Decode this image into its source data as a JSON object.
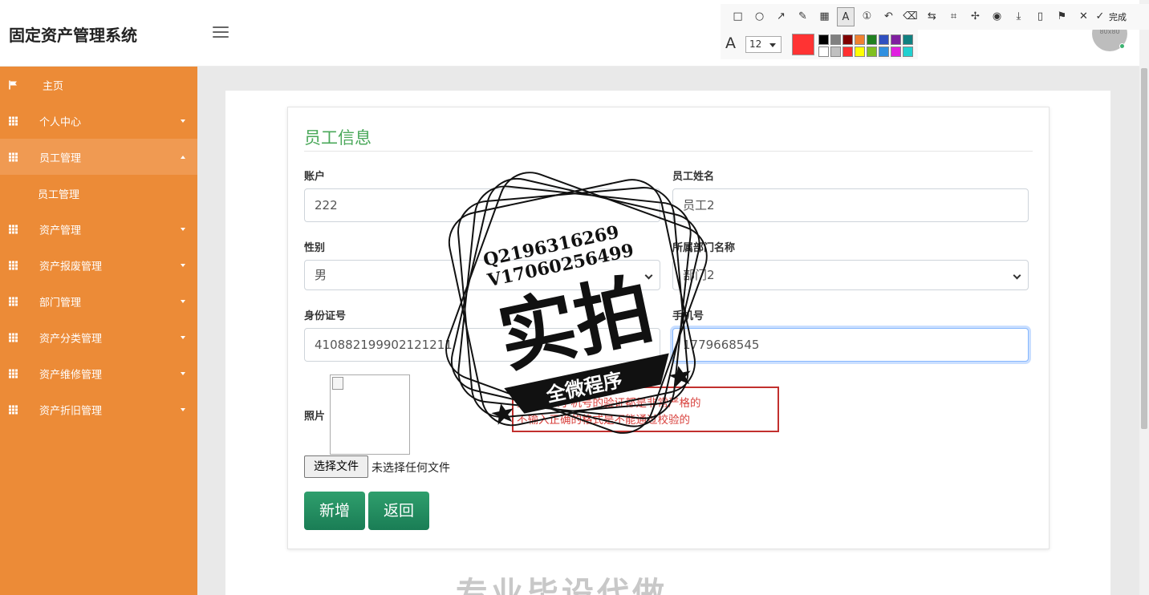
{
  "app": {
    "title": "固定资产管理系统"
  },
  "sidebar": {
    "items": [
      {
        "label": "主页",
        "icon": "flag-icon",
        "caret": "none"
      },
      {
        "label": "个人中心",
        "icon": "grid-icon",
        "caret": "down"
      },
      {
        "label": "员工管理",
        "icon": "grid-icon",
        "caret": "up",
        "active": true
      },
      {
        "label": "资产管理",
        "icon": "grid-icon",
        "caret": "down"
      },
      {
        "label": "资产报废管理",
        "icon": "grid-icon",
        "caret": "down"
      },
      {
        "label": "部门管理",
        "icon": "grid-icon",
        "caret": "down"
      },
      {
        "label": "资产分类管理",
        "icon": "grid-icon",
        "caret": "down"
      },
      {
        "label": "资产维修管理",
        "icon": "grid-icon",
        "caret": "down"
      },
      {
        "label": "资产折旧管理",
        "icon": "grid-icon",
        "caret": "down"
      }
    ],
    "sub_item": "员工管理"
  },
  "header": {
    "avatar_text": "80x80"
  },
  "form": {
    "title": "员工信息",
    "account": {
      "label": "账户",
      "value": "222"
    },
    "name": {
      "label": "员工姓名",
      "value": "员工2"
    },
    "gender": {
      "label": "性别",
      "value": "男"
    },
    "department": {
      "label": "所属部门名称",
      "value": "部门2"
    },
    "id_card": {
      "label": "身份证号",
      "value": "410882199902121211"
    },
    "phone": {
      "label": "手机号",
      "value": "1779668545"
    },
    "photo": {
      "label": "照片"
    },
    "file_button": "选择文件",
    "file_status": "未选择任何文件",
    "submit_label": "新增",
    "back_label": "返回"
  },
  "annotation": {
    "line1": "身份证和手机号的验证都是非常严格的",
    "line2": "不输入正确的格式是不能通过校验的"
  },
  "watermark": {
    "contact1": "Q2196316269",
    "contact2": "V17060256499",
    "main": "实拍",
    "banner": "全微程序",
    "bottom": "专业毕设代做"
  },
  "toolbar": {
    "done_label": "完成",
    "font_size": "12",
    "current_color": "#ff3333",
    "palette": [
      "#000000",
      "#808080",
      "#800000",
      "#f08030",
      "#208020",
      "#3050c0",
      "#8020a0",
      "#108080",
      "#ffffff",
      "#c0c0c0",
      "#ff3030",
      "#ffff00",
      "#80c020",
      "#3090e0",
      "#e020e0",
      "#20d0d0"
    ]
  }
}
